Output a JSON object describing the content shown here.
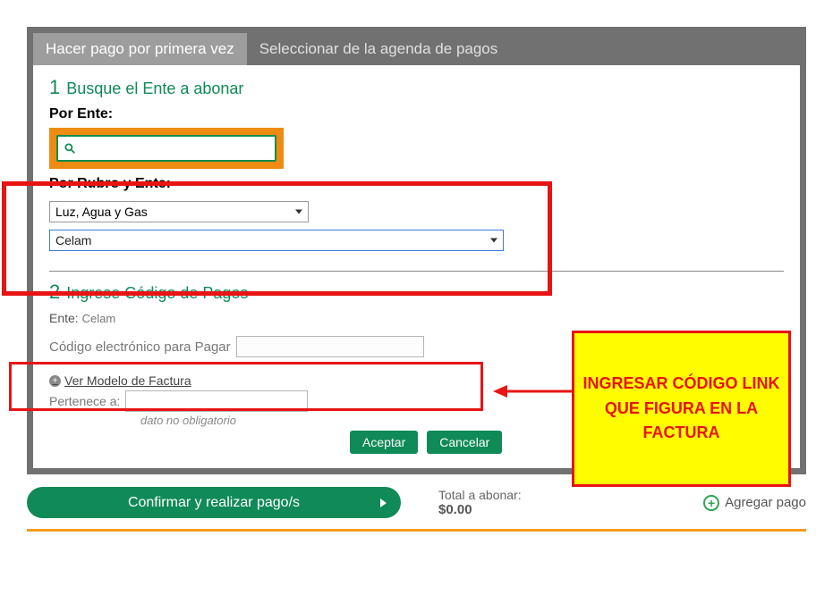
{
  "tabs": {
    "active": "Hacer pago por primera vez",
    "inactive": "Seleccionar de la agenda de pagos"
  },
  "step1": {
    "title": "Busque el Ente a abonar",
    "por_ente": "Por Ente:",
    "por_rubro": "Por Rubro y Ente:",
    "rubro_value": "Luz, Agua y Gas",
    "ente_value": "Celam"
  },
  "step2": {
    "title": "Ingrese Código de Pagos",
    "ente_label": "Ente:",
    "ente_name": "Celam",
    "code_label": "Código electrónico para Pagar",
    "ver_modelo": "Ver Modelo de Factura",
    "pertenece": "Pertenece a:",
    "hint": "dato no obligatorio",
    "aceptar": "Aceptar",
    "cancelar": "Cancelar"
  },
  "callout": "INGRESAR CÓDIGO LINK QUE FIGURA EN LA FACTURA",
  "bottom": {
    "confirm": "Confirmar y realizar pago/s",
    "total_label": "Total a abonar:",
    "total_value": "$0.00",
    "add": "Agregar pago"
  }
}
